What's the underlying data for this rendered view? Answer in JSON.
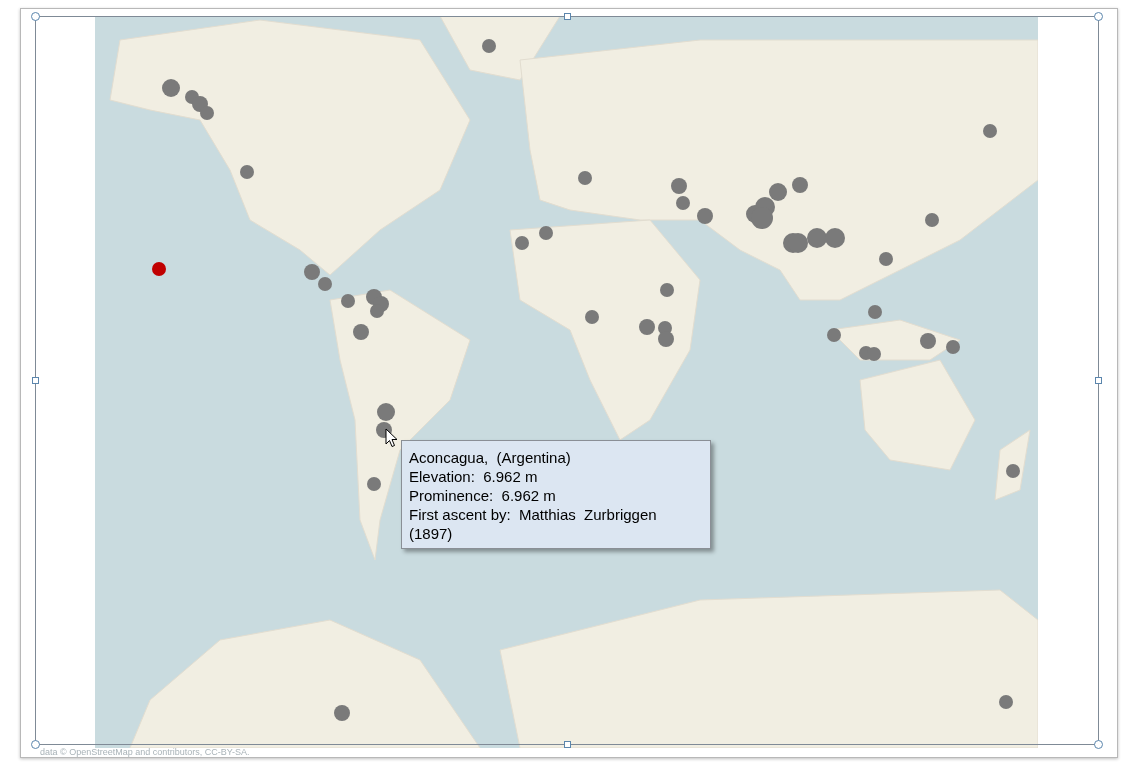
{
  "map": {
    "kind": "picture",
    "attribution": "data © OpenStreetMap and contributors, CC-BY-SA."
  },
  "tooltip": {
    "lines": [
      "Aconcagua,  (Argentina)",
      "Elevation:  6.962 m",
      "Prominence:  6.962 m",
      "First ascent by:  Matthias  Zurbriggen",
      "(1897)"
    ]
  }
}
